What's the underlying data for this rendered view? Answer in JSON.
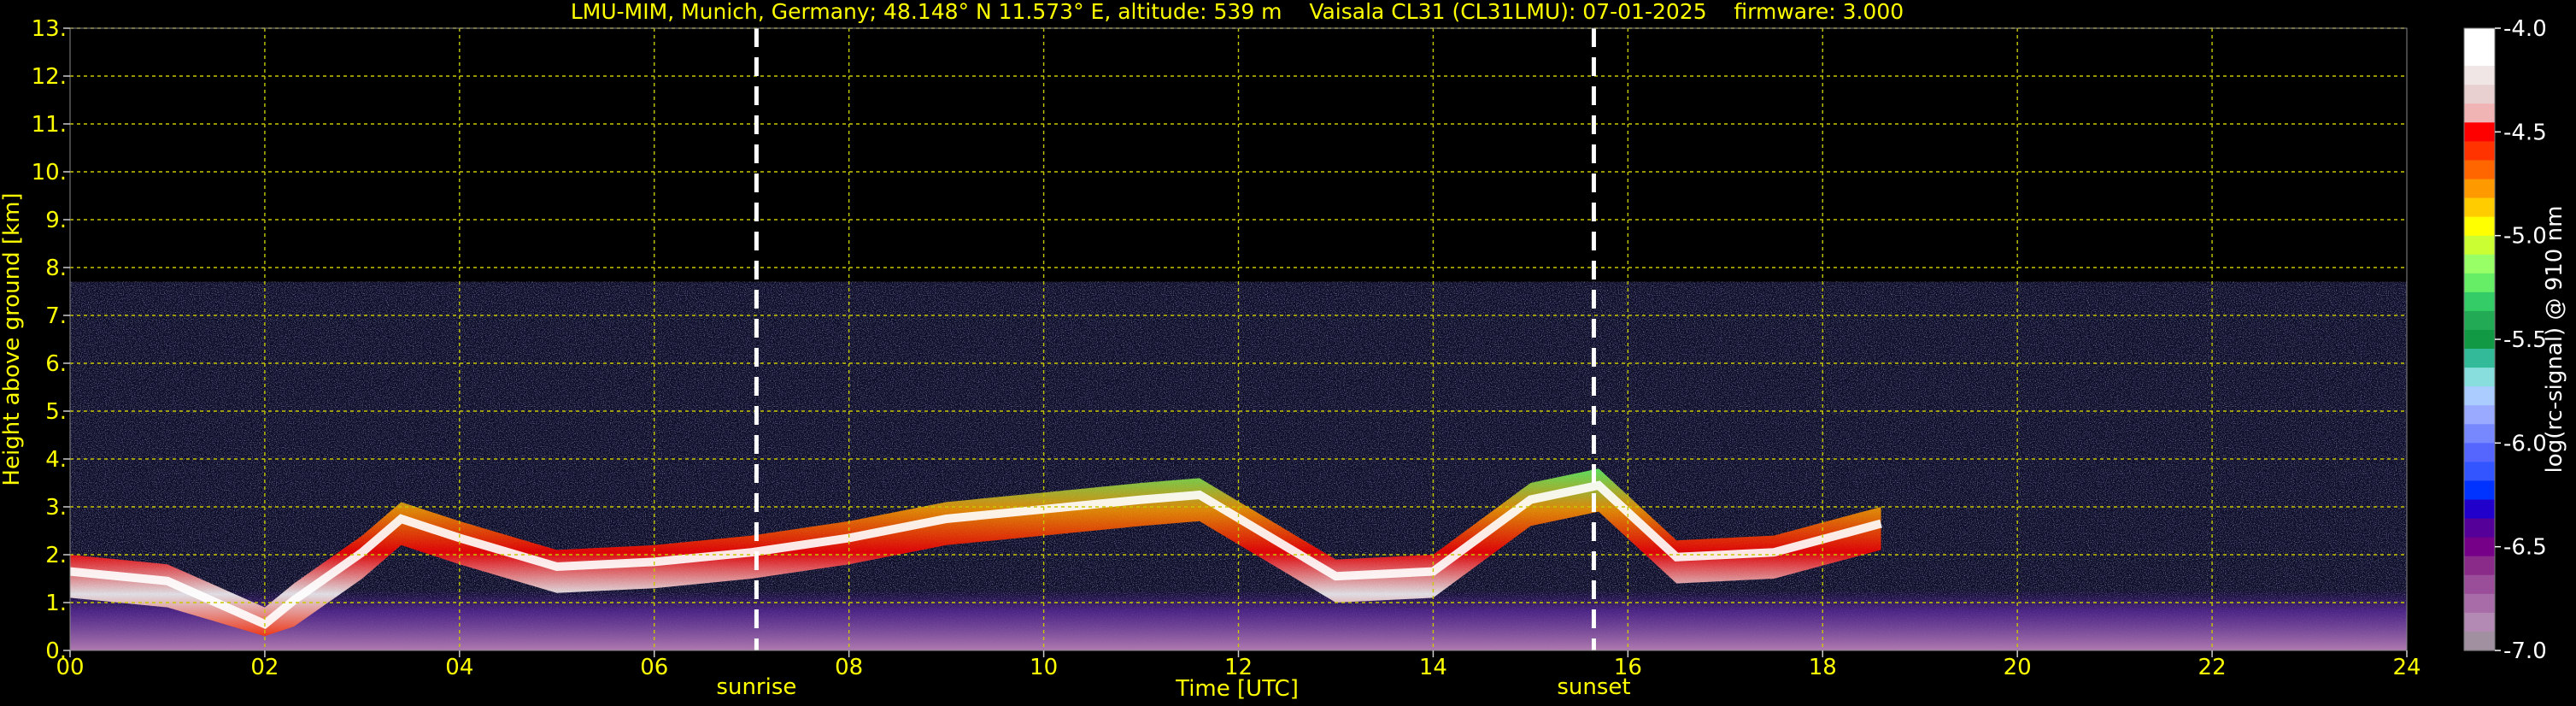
{
  "chart_data": {
    "type": "heatmap",
    "title": "LMU-MIM, Munich, Germany; 48.148° N 11.573° E, altitude: 539 m    Vaisala CL31 (CL31LMU): 07-01-2025    firmware: 3.000",
    "xlabel": "Time [UTC]",
    "ylabel": "Height above ground [km]",
    "colorbar_label": "log(rc-signal) @ 910 nm",
    "xlim": [
      0,
      24
    ],
    "ylim": [
      0,
      13
    ],
    "x_ticks": [
      0,
      2,
      4,
      6,
      8,
      10,
      12,
      14,
      16,
      18,
      20,
      22,
      24
    ],
    "x_tick_labels": [
      "00",
      "02",
      "04",
      "06",
      "08",
      "10",
      "12",
      "14",
      "16",
      "18",
      "20",
      "22",
      "24"
    ],
    "y_ticks": [
      0,
      1,
      2,
      3,
      4,
      5,
      6,
      7,
      8,
      9,
      10,
      11,
      12,
      13
    ],
    "y_tick_labels": [
      "0.",
      "1.",
      "2.",
      "3.",
      "4.",
      "5.",
      "6.",
      "7.",
      "8.",
      "9.",
      "10.",
      "11.",
      "12.",
      "13."
    ],
    "grid": true,
    "colorbar_range": [
      -7.0,
      -4.0
    ],
    "colorbar_ticks": [
      "-4.0",
      "-4.5",
      "-5.0",
      "-5.5",
      "-6.0",
      "-6.5",
      "-7.0"
    ],
    "markers": [
      {
        "label": "sunrise",
        "time": 7.05
      },
      {
        "label": "sunset",
        "time": 15.65
      }
    ],
    "signal_top_km": 7.7,
    "boundary_layer_top": [
      {
        "t": 0.0,
        "h": 2.0
      },
      {
        "t": 1.0,
        "h": 1.8
      },
      {
        "t": 2.0,
        "h": 0.9
      },
      {
        "t": 2.3,
        "h": 1.4
      },
      {
        "t": 3.0,
        "h": 2.4
      },
      {
        "t": 3.4,
        "h": 3.1
      },
      {
        "t": 4.0,
        "h": 2.7
      },
      {
        "t": 5.0,
        "h": 2.1
      },
      {
        "t": 6.0,
        "h": 2.2
      },
      {
        "t": 7.0,
        "h": 2.4
      },
      {
        "t": 8.0,
        "h": 2.7
      },
      {
        "t": 9.0,
        "h": 3.1
      },
      {
        "t": 10.0,
        "h": 3.3
      },
      {
        "t": 11.0,
        "h": 3.5
      },
      {
        "t": 11.6,
        "h": 3.6
      },
      {
        "t": 13.0,
        "h": 1.9
      },
      {
        "t": 14.0,
        "h": 2.0
      },
      {
        "t": 15.0,
        "h": 3.5
      },
      {
        "t": 15.7,
        "h": 3.8
      },
      {
        "t": 16.5,
        "h": 2.3
      },
      {
        "t": 17.5,
        "h": 2.4
      },
      {
        "t": 18.6,
        "h": 3.0
      }
    ]
  },
  "colors": {
    "text": "#ffff00",
    "grid": "#c8c800",
    "background": "#000000",
    "marker": "#ffffff"
  },
  "colorbar_colors": [
    "#ffffff",
    "#ffffff",
    "#f0e6e6",
    "#e8d0d0",
    "#f0b4b4",
    "#ff0000",
    "#ff3300",
    "#ff6600",
    "#ff9900",
    "#ffcc00",
    "#ffff00",
    "#ccff33",
    "#99ff66",
    "#66ee66",
    "#33cc66",
    "#22aa55",
    "#119944",
    "#33bb99",
    "#88dddd",
    "#aaccff",
    "#99aaff",
    "#7788ff",
    "#5566ff",
    "#3355ff",
    "#0033ff",
    "#2200cc",
    "#550099",
    "#770088",
    "#8a2b8a",
    "#9a4e9a",
    "#a86ca8",
    "#b38ab3",
    "#a090a0"
  ]
}
